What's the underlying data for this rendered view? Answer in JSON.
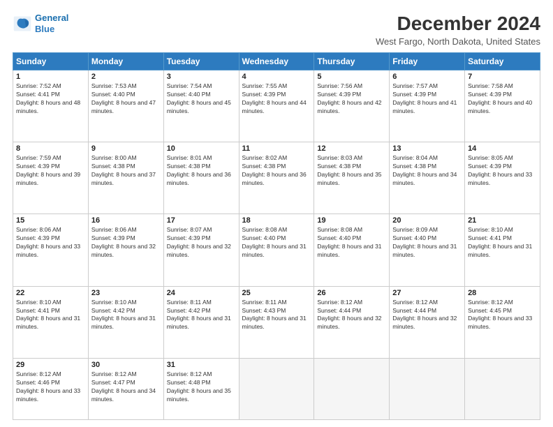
{
  "logo": {
    "line1": "General",
    "line2": "Blue"
  },
  "title": "December 2024",
  "location": "West Fargo, North Dakota, United States",
  "days_header": [
    "Sunday",
    "Monday",
    "Tuesday",
    "Wednesday",
    "Thursday",
    "Friday",
    "Saturday"
  ],
  "weeks": [
    [
      {
        "day": "1",
        "sunrise": "7:52 AM",
        "sunset": "4:41 PM",
        "daylight": "8 hours and 48 minutes."
      },
      {
        "day": "2",
        "sunrise": "7:53 AM",
        "sunset": "4:40 PM",
        "daylight": "8 hours and 47 minutes."
      },
      {
        "day": "3",
        "sunrise": "7:54 AM",
        "sunset": "4:40 PM",
        "daylight": "8 hours and 45 minutes."
      },
      {
        "day": "4",
        "sunrise": "7:55 AM",
        "sunset": "4:39 PM",
        "daylight": "8 hours and 44 minutes."
      },
      {
        "day": "5",
        "sunrise": "7:56 AM",
        "sunset": "4:39 PM",
        "daylight": "8 hours and 42 minutes."
      },
      {
        "day": "6",
        "sunrise": "7:57 AM",
        "sunset": "4:39 PM",
        "daylight": "8 hours and 41 minutes."
      },
      {
        "day": "7",
        "sunrise": "7:58 AM",
        "sunset": "4:39 PM",
        "daylight": "8 hours and 40 minutes."
      }
    ],
    [
      {
        "day": "8",
        "sunrise": "7:59 AM",
        "sunset": "4:39 PM",
        "daylight": "8 hours and 39 minutes."
      },
      {
        "day": "9",
        "sunrise": "8:00 AM",
        "sunset": "4:38 PM",
        "daylight": "8 hours and 37 minutes."
      },
      {
        "day": "10",
        "sunrise": "8:01 AM",
        "sunset": "4:38 PM",
        "daylight": "8 hours and 36 minutes."
      },
      {
        "day": "11",
        "sunrise": "8:02 AM",
        "sunset": "4:38 PM",
        "daylight": "8 hours and 36 minutes."
      },
      {
        "day": "12",
        "sunrise": "8:03 AM",
        "sunset": "4:38 PM",
        "daylight": "8 hours and 35 minutes."
      },
      {
        "day": "13",
        "sunrise": "8:04 AM",
        "sunset": "4:38 PM",
        "daylight": "8 hours and 34 minutes."
      },
      {
        "day": "14",
        "sunrise": "8:05 AM",
        "sunset": "4:39 PM",
        "daylight": "8 hours and 33 minutes."
      }
    ],
    [
      {
        "day": "15",
        "sunrise": "8:06 AM",
        "sunset": "4:39 PM",
        "daylight": "8 hours and 33 minutes."
      },
      {
        "day": "16",
        "sunrise": "8:06 AM",
        "sunset": "4:39 PM",
        "daylight": "8 hours and 32 minutes."
      },
      {
        "day": "17",
        "sunrise": "8:07 AM",
        "sunset": "4:39 PM",
        "daylight": "8 hours and 32 minutes."
      },
      {
        "day": "18",
        "sunrise": "8:08 AM",
        "sunset": "4:40 PM",
        "daylight": "8 hours and 31 minutes."
      },
      {
        "day": "19",
        "sunrise": "8:08 AM",
        "sunset": "4:40 PM",
        "daylight": "8 hours and 31 minutes."
      },
      {
        "day": "20",
        "sunrise": "8:09 AM",
        "sunset": "4:40 PM",
        "daylight": "8 hours and 31 minutes."
      },
      {
        "day": "21",
        "sunrise": "8:10 AM",
        "sunset": "4:41 PM",
        "daylight": "8 hours and 31 minutes."
      }
    ],
    [
      {
        "day": "22",
        "sunrise": "8:10 AM",
        "sunset": "4:41 PM",
        "daylight": "8 hours and 31 minutes."
      },
      {
        "day": "23",
        "sunrise": "8:10 AM",
        "sunset": "4:42 PM",
        "daylight": "8 hours and 31 minutes."
      },
      {
        "day": "24",
        "sunrise": "8:11 AM",
        "sunset": "4:42 PM",
        "daylight": "8 hours and 31 minutes."
      },
      {
        "day": "25",
        "sunrise": "8:11 AM",
        "sunset": "4:43 PM",
        "daylight": "8 hours and 31 minutes."
      },
      {
        "day": "26",
        "sunrise": "8:12 AM",
        "sunset": "4:44 PM",
        "daylight": "8 hours and 32 minutes."
      },
      {
        "day": "27",
        "sunrise": "8:12 AM",
        "sunset": "4:44 PM",
        "daylight": "8 hours and 32 minutes."
      },
      {
        "day": "28",
        "sunrise": "8:12 AM",
        "sunset": "4:45 PM",
        "daylight": "8 hours and 33 minutes."
      }
    ],
    [
      {
        "day": "29",
        "sunrise": "8:12 AM",
        "sunset": "4:46 PM",
        "daylight": "8 hours and 33 minutes."
      },
      {
        "day": "30",
        "sunrise": "8:12 AM",
        "sunset": "4:47 PM",
        "daylight": "8 hours and 34 minutes."
      },
      {
        "day": "31",
        "sunrise": "8:12 AM",
        "sunset": "4:48 PM",
        "daylight": "8 hours and 35 minutes."
      },
      null,
      null,
      null,
      null
    ]
  ],
  "labels": {
    "sunrise": "Sunrise:",
    "sunset": "Sunset:",
    "daylight": "Daylight:"
  }
}
